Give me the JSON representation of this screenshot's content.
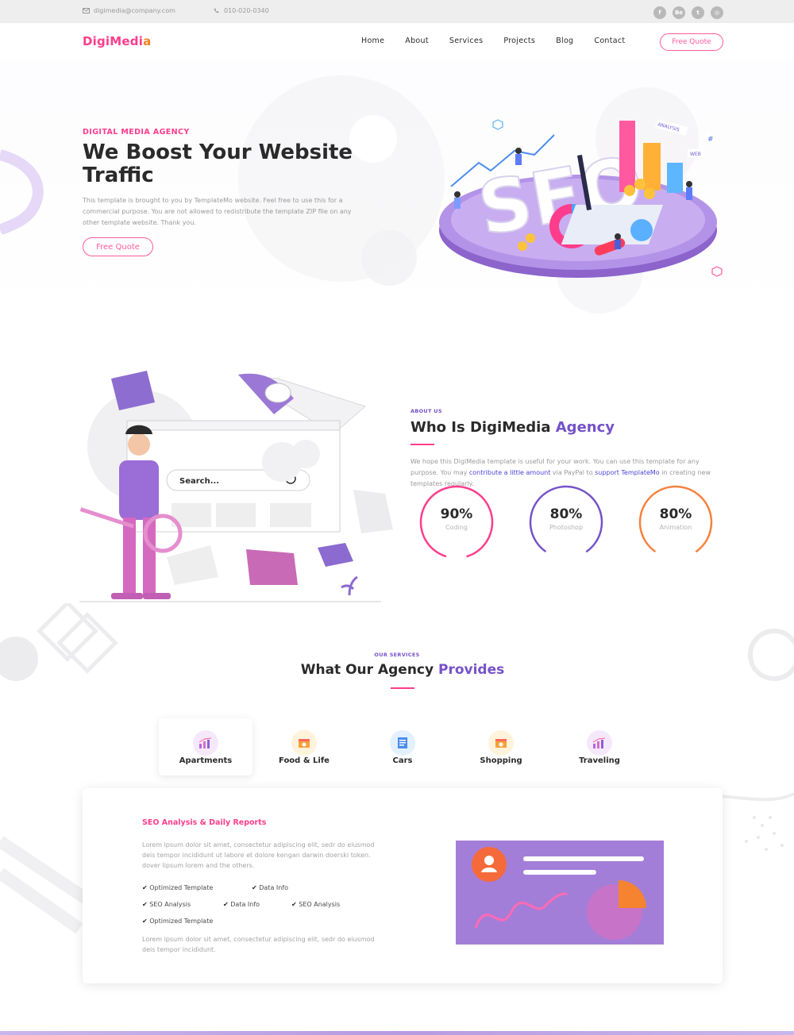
{
  "topbar": {
    "email": "digimedia@company.com",
    "phone": "010-020-0340",
    "socials": [
      {
        "icon": "facebook-icon",
        "glyph": "f"
      },
      {
        "icon": "behance-icon",
        "glyph": "Be"
      },
      {
        "icon": "twitter-icon",
        "glyph": "t"
      },
      {
        "icon": "dribbble-icon",
        "glyph": "◎"
      }
    ]
  },
  "header": {
    "logo_main": "DigiMedi",
    "logo_tail": "a",
    "nav": [
      "Home",
      "About",
      "Services",
      "Projects",
      "Blog",
      "Contact"
    ],
    "cta": "Free Quote"
  },
  "hero": {
    "kicker": "DIGITAL MEDIA AGENCY",
    "title": "We Boost Your Website Traffic",
    "description": "This template is brought to you by TemplateMo website. Feel free to use this for a commercial purpose. You are not allowed to redistribute the template ZIP file on any other template website. Thank you.",
    "button": "Free Quote",
    "illustration_text": "SEO",
    "illustration_tags": [
      "ANALYSIS",
      "WEB",
      "#"
    ]
  },
  "about": {
    "kicker": "ABOUT US",
    "title_main": "Who Is DigiMedia",
    "title_accent": "Agency",
    "desc_1": "We hope this DigiMedia template is useful for your work. You can use this template for any purpose. You may ",
    "desc_link_1": "contribute a little amount",
    "desc_2": " via PayPal to ",
    "desc_link_2": "support TemplateMo",
    "desc_3": " in creating new templates regularly.",
    "search_label": "Search...",
    "stats": [
      {
        "value": "90%",
        "label": "Coding",
        "percent": 90,
        "color": "#ff3d8c"
      },
      {
        "value": "80%",
        "label": "Photoshop",
        "percent": 80,
        "color": "#7652c9"
      },
      {
        "value": "80%",
        "label": "Animation",
        "percent": 80,
        "color": "#f5823e"
      }
    ]
  },
  "services": {
    "kicker": "OUR SERVICES",
    "title_main": "What Our Agency",
    "title_accent": "Provides",
    "tabs": [
      {
        "label": "Apartments",
        "icon": "chart-icon",
        "active": true
      },
      {
        "label": "Food & Life",
        "icon": "food-icon",
        "active": false
      },
      {
        "label": "Cars",
        "icon": "document-icon",
        "active": false
      },
      {
        "label": "Shopping",
        "icon": "shopping-icon",
        "active": false
      },
      {
        "label": "Traveling",
        "icon": "chart-icon",
        "active": false
      }
    ],
    "panel": {
      "title": "SEO Analysis & Daily Reports",
      "para_1": "Lorem ipsum dolor sit amet, consectetur adipiscing elit, sedr do eiusmod deis tempor incididunt ut labore et dolore kengan darwin doerski token. dover lipsum lorem and the others.",
      "checks": [
        "Optimized Template",
        "Data Info",
        "SEO Analysis",
        "Data Info",
        "SEO Analysis",
        "Optimized Template"
      ],
      "para_2": "Lorem ipsum dolor sit amet, consectetur adipiscing elit, sedr do eiusmod deis tempor incididunt."
    }
  },
  "colors": {
    "brand_pink": "#ff3d8c",
    "brand_purple": "#7652c9",
    "brand_orange": "#f58220"
  }
}
